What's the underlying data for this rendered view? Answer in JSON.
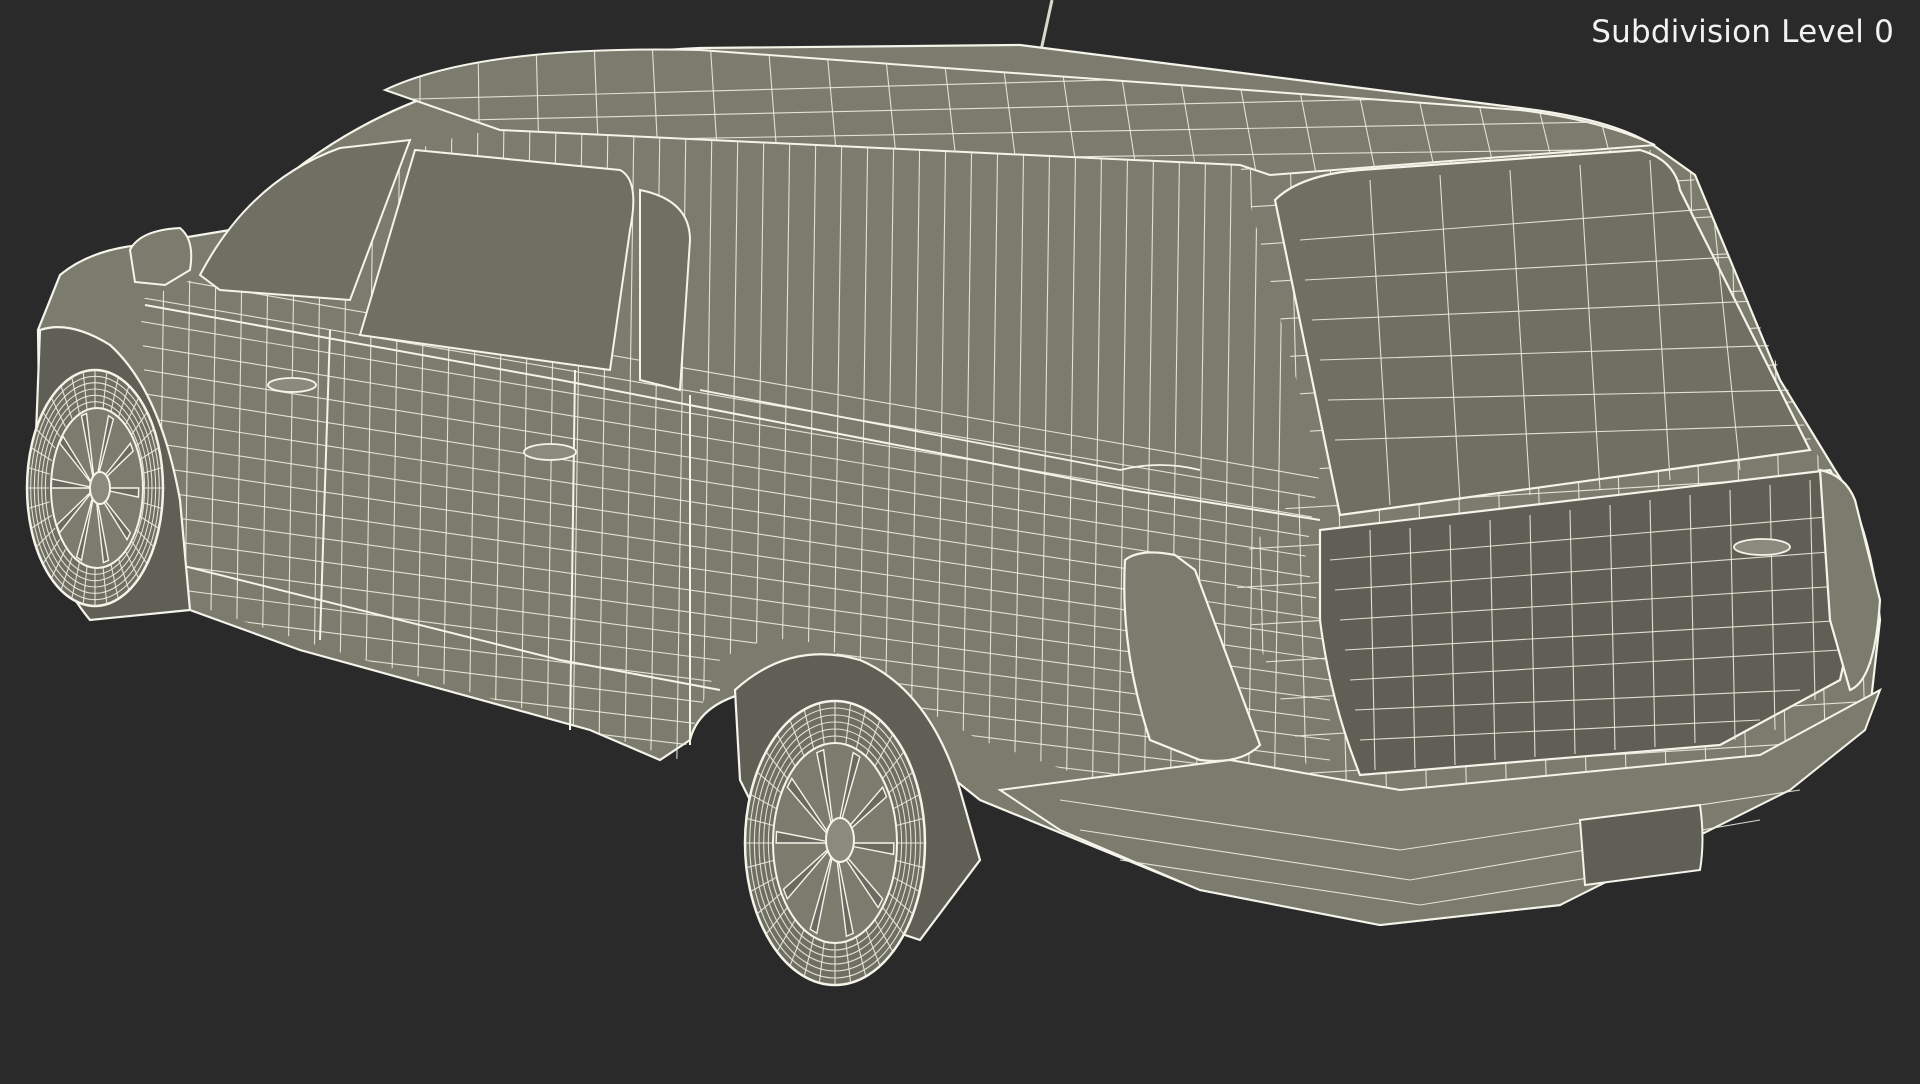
{
  "viewport": {
    "overlay_label": "Subdivision Level 0",
    "background_color": "#2a2a2a",
    "model_color": "#7b7b6e",
    "wire_color": "#f4f4ea",
    "subject": "wireframe-station-wagon-model"
  }
}
